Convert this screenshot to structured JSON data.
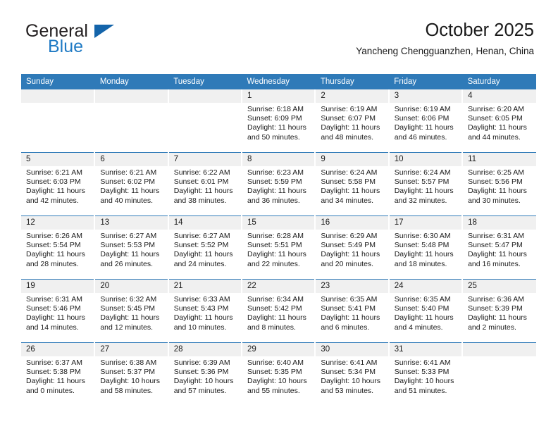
{
  "brand": {
    "name_top": "General",
    "name_bottom": "Blue",
    "colors": {
      "accent": "#2f7ab8",
      "logo_blue": "#1f7ac4",
      "band_gray": "#f0f0f0"
    }
  },
  "header": {
    "title": "October 2025",
    "subtitle": "Yancheng Chengguanzhen, Henan, China"
  },
  "weekday_headers": [
    "Sunday",
    "Monday",
    "Tuesday",
    "Wednesday",
    "Thursday",
    "Friday",
    "Saturday"
  ],
  "weeks": [
    [
      {
        "day": "",
        "sunrise": "",
        "sunset": "",
        "daylight": "",
        "empty": true
      },
      {
        "day": "",
        "sunrise": "",
        "sunset": "",
        "daylight": "",
        "empty": true
      },
      {
        "day": "",
        "sunrise": "",
        "sunset": "",
        "daylight": "",
        "empty": true
      },
      {
        "day": "1",
        "sunrise": "Sunrise: 6:18 AM",
        "sunset": "Sunset: 6:09 PM",
        "daylight": "Daylight: 11 hours and 50 minutes."
      },
      {
        "day": "2",
        "sunrise": "Sunrise: 6:19 AM",
        "sunset": "Sunset: 6:07 PM",
        "daylight": "Daylight: 11 hours and 48 minutes."
      },
      {
        "day": "3",
        "sunrise": "Sunrise: 6:19 AM",
        "sunset": "Sunset: 6:06 PM",
        "daylight": "Daylight: 11 hours and 46 minutes."
      },
      {
        "day": "4",
        "sunrise": "Sunrise: 6:20 AM",
        "sunset": "Sunset: 6:05 PM",
        "daylight": "Daylight: 11 hours and 44 minutes."
      }
    ],
    [
      {
        "day": "5",
        "sunrise": "Sunrise: 6:21 AM",
        "sunset": "Sunset: 6:03 PM",
        "daylight": "Daylight: 11 hours and 42 minutes."
      },
      {
        "day": "6",
        "sunrise": "Sunrise: 6:21 AM",
        "sunset": "Sunset: 6:02 PM",
        "daylight": "Daylight: 11 hours and 40 minutes."
      },
      {
        "day": "7",
        "sunrise": "Sunrise: 6:22 AM",
        "sunset": "Sunset: 6:01 PM",
        "daylight": "Daylight: 11 hours and 38 minutes."
      },
      {
        "day": "8",
        "sunrise": "Sunrise: 6:23 AM",
        "sunset": "Sunset: 5:59 PM",
        "daylight": "Daylight: 11 hours and 36 minutes."
      },
      {
        "day": "9",
        "sunrise": "Sunrise: 6:24 AM",
        "sunset": "Sunset: 5:58 PM",
        "daylight": "Daylight: 11 hours and 34 minutes."
      },
      {
        "day": "10",
        "sunrise": "Sunrise: 6:24 AM",
        "sunset": "Sunset: 5:57 PM",
        "daylight": "Daylight: 11 hours and 32 minutes."
      },
      {
        "day": "11",
        "sunrise": "Sunrise: 6:25 AM",
        "sunset": "Sunset: 5:56 PM",
        "daylight": "Daylight: 11 hours and 30 minutes."
      }
    ],
    [
      {
        "day": "12",
        "sunrise": "Sunrise: 6:26 AM",
        "sunset": "Sunset: 5:54 PM",
        "daylight": "Daylight: 11 hours and 28 minutes."
      },
      {
        "day": "13",
        "sunrise": "Sunrise: 6:27 AM",
        "sunset": "Sunset: 5:53 PM",
        "daylight": "Daylight: 11 hours and 26 minutes."
      },
      {
        "day": "14",
        "sunrise": "Sunrise: 6:27 AM",
        "sunset": "Sunset: 5:52 PM",
        "daylight": "Daylight: 11 hours and 24 minutes."
      },
      {
        "day": "15",
        "sunrise": "Sunrise: 6:28 AM",
        "sunset": "Sunset: 5:51 PM",
        "daylight": "Daylight: 11 hours and 22 minutes."
      },
      {
        "day": "16",
        "sunrise": "Sunrise: 6:29 AM",
        "sunset": "Sunset: 5:49 PM",
        "daylight": "Daylight: 11 hours and 20 minutes."
      },
      {
        "day": "17",
        "sunrise": "Sunrise: 6:30 AM",
        "sunset": "Sunset: 5:48 PM",
        "daylight": "Daylight: 11 hours and 18 minutes."
      },
      {
        "day": "18",
        "sunrise": "Sunrise: 6:31 AM",
        "sunset": "Sunset: 5:47 PM",
        "daylight": "Daylight: 11 hours and 16 minutes."
      }
    ],
    [
      {
        "day": "19",
        "sunrise": "Sunrise: 6:31 AM",
        "sunset": "Sunset: 5:46 PM",
        "daylight": "Daylight: 11 hours and 14 minutes."
      },
      {
        "day": "20",
        "sunrise": "Sunrise: 6:32 AM",
        "sunset": "Sunset: 5:45 PM",
        "daylight": "Daylight: 11 hours and 12 minutes."
      },
      {
        "day": "21",
        "sunrise": "Sunrise: 6:33 AM",
        "sunset": "Sunset: 5:43 PM",
        "daylight": "Daylight: 11 hours and 10 minutes."
      },
      {
        "day": "22",
        "sunrise": "Sunrise: 6:34 AM",
        "sunset": "Sunset: 5:42 PM",
        "daylight": "Daylight: 11 hours and 8 minutes."
      },
      {
        "day": "23",
        "sunrise": "Sunrise: 6:35 AM",
        "sunset": "Sunset: 5:41 PM",
        "daylight": "Daylight: 11 hours and 6 minutes."
      },
      {
        "day": "24",
        "sunrise": "Sunrise: 6:35 AM",
        "sunset": "Sunset: 5:40 PM",
        "daylight": "Daylight: 11 hours and 4 minutes."
      },
      {
        "day": "25",
        "sunrise": "Sunrise: 6:36 AM",
        "sunset": "Sunset: 5:39 PM",
        "daylight": "Daylight: 11 hours and 2 minutes."
      }
    ],
    [
      {
        "day": "26",
        "sunrise": "Sunrise: 6:37 AM",
        "sunset": "Sunset: 5:38 PM",
        "daylight": "Daylight: 11 hours and 0 minutes."
      },
      {
        "day": "27",
        "sunrise": "Sunrise: 6:38 AM",
        "sunset": "Sunset: 5:37 PM",
        "daylight": "Daylight: 10 hours and 58 minutes."
      },
      {
        "day": "28",
        "sunrise": "Sunrise: 6:39 AM",
        "sunset": "Sunset: 5:36 PM",
        "daylight": "Daylight: 10 hours and 57 minutes."
      },
      {
        "day": "29",
        "sunrise": "Sunrise: 6:40 AM",
        "sunset": "Sunset: 5:35 PM",
        "daylight": "Daylight: 10 hours and 55 minutes."
      },
      {
        "day": "30",
        "sunrise": "Sunrise: 6:41 AM",
        "sunset": "Sunset: 5:34 PM",
        "daylight": "Daylight: 10 hours and 53 minutes."
      },
      {
        "day": "31",
        "sunrise": "Sunrise: 6:41 AM",
        "sunset": "Sunset: 5:33 PM",
        "daylight": "Daylight: 10 hours and 51 minutes."
      },
      {
        "day": "",
        "sunrise": "",
        "sunset": "",
        "daylight": "",
        "empty": true
      }
    ]
  ]
}
